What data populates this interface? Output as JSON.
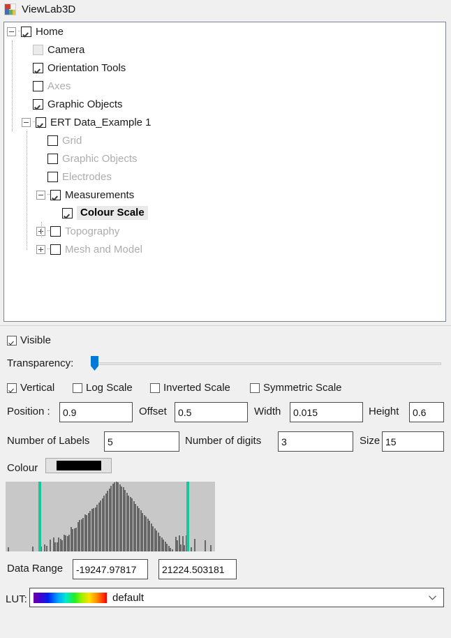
{
  "app": {
    "title": "ViewLab3D",
    "icon": "app-3d-icon"
  },
  "tree": {
    "nodes": [
      {
        "label": "Home",
        "depth": 0,
        "checked": true,
        "dim": false,
        "expander": "minus",
        "selected": false,
        "disabled": false
      },
      {
        "label": "Camera",
        "depth": 1,
        "checked": false,
        "dim": false,
        "expander": "none",
        "selected": false,
        "disabled": true
      },
      {
        "label": "Orientation Tools",
        "depth": 1,
        "checked": true,
        "dim": false,
        "expander": "none",
        "selected": false,
        "disabled": false
      },
      {
        "label": "Axes",
        "depth": 1,
        "checked": false,
        "dim": true,
        "expander": "none",
        "selected": false,
        "disabled": false
      },
      {
        "label": "Graphic Objects",
        "depth": 1,
        "checked": true,
        "dim": false,
        "expander": "none",
        "selected": false,
        "disabled": false
      },
      {
        "label": "ERT Data_Example 1",
        "depth": 1,
        "checked": true,
        "dim": false,
        "expander": "minus",
        "selected": false,
        "disabled": false
      },
      {
        "label": "Grid",
        "depth": 2,
        "checked": false,
        "dim": true,
        "expander": "none",
        "selected": false,
        "disabled": false
      },
      {
        "label": "Graphic Objects",
        "depth": 2,
        "checked": false,
        "dim": true,
        "expander": "none",
        "selected": false,
        "disabled": false
      },
      {
        "label": "Electrodes",
        "depth": 2,
        "checked": false,
        "dim": true,
        "expander": "none",
        "selected": false,
        "disabled": false
      },
      {
        "label": "Measurements",
        "depth": 2,
        "checked": true,
        "dim": false,
        "expander": "minus",
        "selected": false,
        "disabled": false
      },
      {
        "label": "Colour Scale",
        "depth": 3,
        "checked": true,
        "dim": false,
        "expander": "none",
        "selected": true,
        "disabled": false
      },
      {
        "label": "Topography",
        "depth": 2,
        "checked": false,
        "dim": true,
        "expander": "plus",
        "selected": false,
        "disabled": false
      },
      {
        "label": "Mesh and Model",
        "depth": 2,
        "checked": false,
        "dim": true,
        "expander": "plus",
        "selected": false,
        "disabled": false
      }
    ]
  },
  "properties": {
    "visible": {
      "label": "Visible",
      "checked": true
    },
    "transparency": {
      "label": "Transparency:",
      "value": 0
    },
    "flags": [
      {
        "label": "Vertical",
        "checked": true
      },
      {
        "label": "Log Scale",
        "checked": false
      },
      {
        "label": "Inverted Scale",
        "checked": false
      },
      {
        "label": "Symmetric Scale",
        "checked": false
      }
    ],
    "position": {
      "label": "Position :",
      "value": "0.9"
    },
    "offset": {
      "label": "Offset",
      "value": "0.5"
    },
    "width": {
      "label": "Width",
      "value": "0.015"
    },
    "height": {
      "label": "Height",
      "value": "0.6"
    },
    "number_of_labels": {
      "label": "Number of Labels",
      "value": "5"
    },
    "number_of_digits": {
      "label": "Number of digits",
      "value": "3"
    },
    "size": {
      "label": "Size",
      "value": "15"
    },
    "colour": {
      "label": "Colour",
      "swatch": "#000000"
    },
    "data_range": {
      "label": "Data Range",
      "min": "-19247.97817",
      "max": "21224.503181"
    },
    "lut": {
      "label": "LUT:",
      "selected": "default",
      "gradient": "purple-blue-cyan-green-yellow-orange-red"
    }
  },
  "chart_data": {
    "type": "bar",
    "title": "",
    "xlabel": "",
    "ylabel": "",
    "grid": false,
    "legend": false,
    "bar_color": "#676767",
    "background": "#c8c8c8",
    "marker_color": "#16c79a",
    "markers": [
      0.155,
      0.862
    ],
    "ylim": [
      0,
      1
    ],
    "values": [
      0.0,
      0.06,
      0.0,
      0.0,
      0.0,
      0.0,
      0.0,
      0.0,
      0.0,
      0.0,
      0.0,
      0.0,
      0.0,
      0.0,
      0.0,
      0.07,
      0.0,
      0.0,
      0.0,
      0.0,
      0.07,
      0.0,
      0.1,
      0.08,
      0.0,
      0.17,
      0.0,
      0.2,
      0.13,
      0.13,
      0.2,
      0.18,
      0.16,
      0.24,
      0.23,
      0.22,
      0.24,
      0.35,
      0.32,
      0.33,
      0.34,
      0.42,
      0.45,
      0.46,
      0.48,
      0.53,
      0.52,
      0.55,
      0.58,
      0.61,
      0.62,
      0.63,
      0.67,
      0.7,
      0.73,
      0.76,
      0.8,
      0.83,
      0.87,
      0.9,
      0.94,
      0.97,
      0.99,
      1.0,
      0.99,
      0.96,
      0.93,
      0.92,
      0.88,
      0.84,
      0.8,
      0.78,
      0.76,
      0.72,
      0.68,
      0.65,
      0.62,
      0.59,
      0.55,
      0.52,
      0.5,
      0.47,
      0.44,
      0.4,
      0.36,
      0.33,
      0.3,
      0.27,
      0.22,
      0.2,
      0.17,
      0.14,
      0.11,
      0.08,
      0.05,
      0.03,
      0.0,
      0.21,
      0.16,
      0.23,
      0.1,
      0.22,
      0.09,
      0.23,
      0.0,
      0.0,
      0.06,
      0.0,
      0.18,
      0.0,
      0.0,
      0.0,
      0.0,
      0.0,
      0.16,
      0.0,
      0.0,
      0.09,
      0.0,
      0.0
    ]
  }
}
